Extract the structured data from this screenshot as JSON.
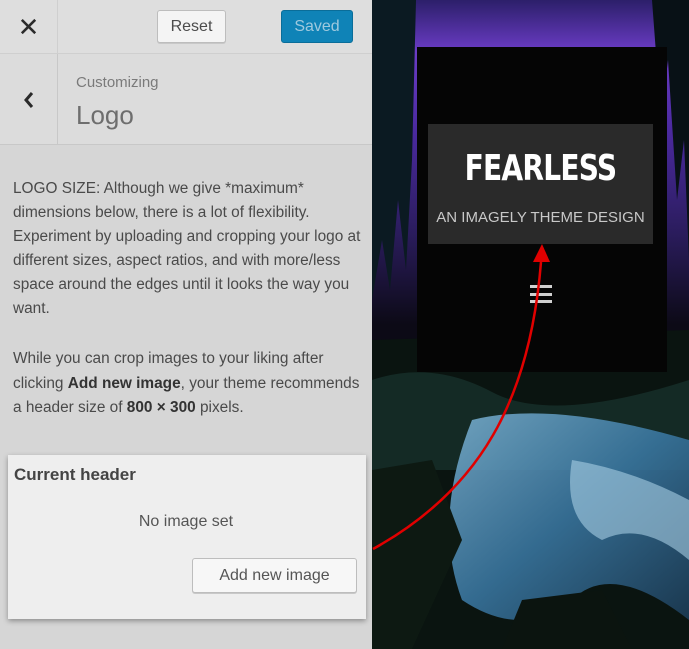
{
  "topbar": {
    "close_icon": "close-icon",
    "reset_label": "Reset",
    "saved_label": "Saved",
    "saved_color": "#0f83b7"
  },
  "section": {
    "back_icon": "chevron-left-icon",
    "breadcrumb": "Customizing",
    "title": "Logo"
  },
  "description": {
    "paragraph1": "LOGO SIZE: Although we give *maximum* dimensions below, there is a lot of flexibility. Experiment by uploading and cropping your logo at different sizes, aspect ratios, and with more/less space around the edges until it looks the way you want.",
    "p2_before_link": "While you can crop images to your liking after clicking ",
    "p2_link": "Add new image",
    "p2_middle": ", your theme recommends a header size of ",
    "p2_size": "800 × 300",
    "p2_end": " pixels."
  },
  "current_header": {
    "title": "Current header",
    "status": "No image set",
    "add_button": "Add new image"
  },
  "preview": {
    "logo_title": "FEARLESS",
    "logo_tagline": "AN IMAGELY THEME DESIGN",
    "menu_icon": "hamburger-menu-icon",
    "annotation_color": "#e00000"
  }
}
